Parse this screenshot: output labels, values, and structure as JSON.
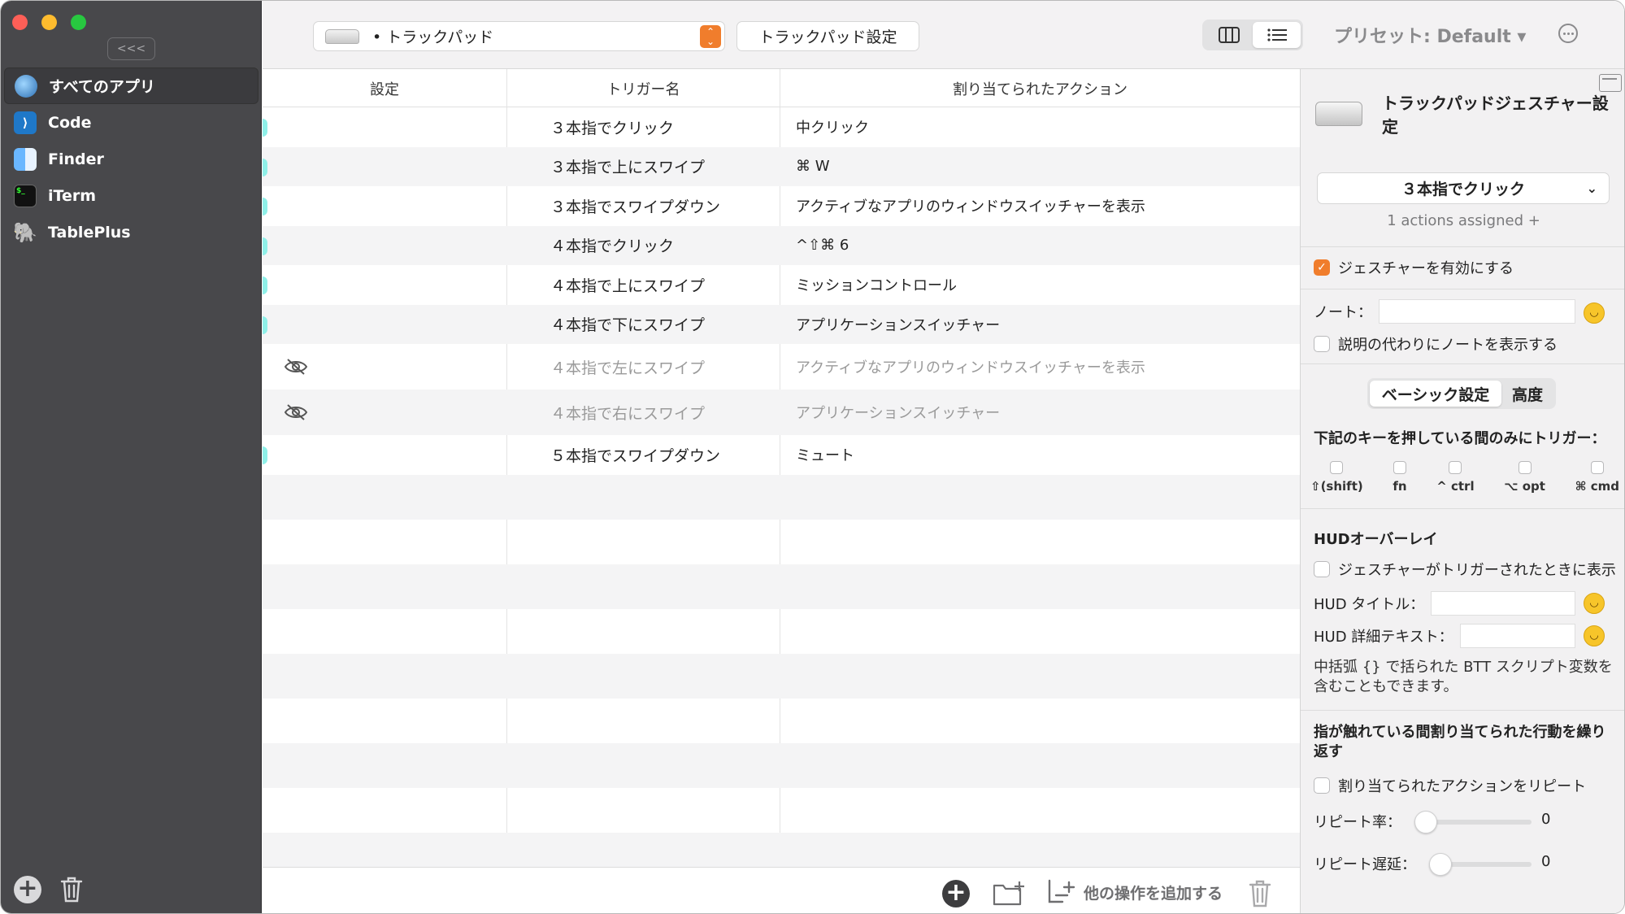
{
  "sidebar": {
    "collapse_label": "<<<",
    "apps": [
      {
        "label": "すべてのアプリ",
        "icon": "globe-icon",
        "selected": true
      },
      {
        "label": "Code",
        "icon": "vscode-icon"
      },
      {
        "label": "Finder",
        "icon": "finder-icon"
      },
      {
        "label": "iTerm",
        "icon": "terminal-icon"
      },
      {
        "label": "TablePlus",
        "icon": "tableplus-icon"
      }
    ]
  },
  "toolbar": {
    "device_label": "• トラックパッド",
    "settings_button": "トラックパッド設定",
    "preset_label": "プリセット: Default ▾"
  },
  "table": {
    "headers": {
      "setting": "設定",
      "trigger": "トリガー名",
      "action": "割り当てられたアクション"
    },
    "rows": [
      {
        "trigger": "３本指でクリック",
        "action": "中クリック",
        "enabled": true
      },
      {
        "trigger": "３本指で上にスワイプ",
        "action": "⌘ W",
        "enabled": true
      },
      {
        "trigger": "３本指でスワイプダウン",
        "action": "アクティブなアプリのウィンドウスイッチャーを表示",
        "enabled": true
      },
      {
        "trigger": "４本指でクリック",
        "action": "^⇧⌘ 6",
        "enabled": true
      },
      {
        "trigger": "４本指で上にスワイプ",
        "action": "ミッションコントロール",
        "enabled": true
      },
      {
        "trigger": "４本指で下にスワイプ",
        "action": "アプリケーションスイッチャー",
        "enabled": true
      },
      {
        "trigger": "４本指で左にスワイプ",
        "action": "アクティブなアプリのウィンドウスイッチャーを表示",
        "enabled": false
      },
      {
        "trigger": "４本指で右にスワイプ",
        "action": "アプリケーションスイッチャー",
        "enabled": false
      },
      {
        "trigger": "５本指でスワイプダウン",
        "action": "ミュート",
        "enabled": true
      }
    ]
  },
  "footer": {
    "add_other_label": "他の操作を追加する"
  },
  "inspector": {
    "title": "トラックパッドジェスチャー設定",
    "gesture_select": "３本指でクリック",
    "actions_assigned": "1 actions assigned +",
    "enable_gesture": "ジェスチャーを有効にする",
    "note_label": "ノート：",
    "show_note": "説明の代わりにノートを表示する",
    "tab_basic": "ベーシック設定",
    "tab_advanced": "高度",
    "modifier_heading": "下記のキーを押している間のみにトリガー：",
    "modifiers": [
      "⇧(shift)",
      "fn",
      "^ ctrl",
      "⌥ opt",
      "⌘ cmd"
    ],
    "hud_heading": "HUDオーバーレイ",
    "hud_show": "ジェスチャーがトリガーされたときに表示",
    "hud_title_label": "HUD タイトル：",
    "hud_detail_label": "HUD 詳細テキスト：",
    "hud_note": "中括弧 {} で括られた BTT スクリプト変数を含むこともできます。",
    "repeat_heading": "指が触れている間割り当てられた行動を繰り返す",
    "repeat_action": "割り当てられたアクションをリピート",
    "repeat_rate_label": "リピート率：",
    "repeat_rate_value": "0",
    "repeat_delay_label": "リピート遅延：",
    "repeat_delay_value": "0"
  },
  "colors": {
    "accent": "#f07d2c",
    "sidebar_bg": "#48484b",
    "row_marker": "#8ff0e8"
  }
}
